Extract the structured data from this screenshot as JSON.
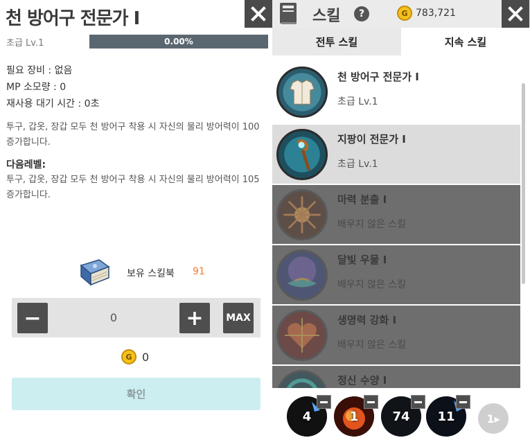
{
  "detail": {
    "title": "천 방어구 전문가 I",
    "level": "초급 Lv.1",
    "progress_text": "0.00%",
    "progress_fraction": 0.0,
    "req_equipment": "필요 장비 : 없음",
    "mp_cost": "MP 소모량 : 0",
    "cooldown": "재사용 대기 시간 : 0초",
    "description": "투구, 갑옷, 장갑 모두 천 방어구 착용 시 자신의 물리 방어력이 100 증가합니다.",
    "next_level_label": "다음레벨:",
    "next_level_description": "투구, 갑옷, 장갑 모두 천 방어구 착용 시 자신의 물리 방어력이 105 증가합니다.",
    "skillbook_label": "보유 스킬북",
    "skillbook_count": "91",
    "stepper": {
      "minus": "−",
      "value": "0",
      "plus": "+",
      "max": "MAX"
    },
    "gold_cost": "0",
    "confirm_label": "확인",
    "close_icon": "close-icon"
  },
  "panel": {
    "title": "스킬",
    "help": "?",
    "gold_symbol": "G",
    "gold_amount": "783,721",
    "tabs": [
      {
        "label": "전투 스킬",
        "active": false
      },
      {
        "label": "지속 스킬",
        "active": true
      }
    ],
    "skills": [
      {
        "name": "천 방어구 전문가 I",
        "status": "초급 Lv.1",
        "state": "learned",
        "icon": "cloth-armor-icon"
      },
      {
        "name": "지팡이 전문가 I",
        "status": "초급 Lv.1",
        "state": "selected",
        "icon": "staff-icon"
      },
      {
        "name": "마력 분출 I",
        "status": "배우지 않은 스킬",
        "state": "locked",
        "icon": "mana-burst-icon"
      },
      {
        "name": "달빛 우물 I",
        "status": "배우지 않은 스킬",
        "state": "locked",
        "icon": "moonlight-well-icon"
      },
      {
        "name": "생명력 강화 I",
        "status": "배우지 않은 스킬",
        "state": "locked",
        "icon": "vitality-icon"
      },
      {
        "name": "정신 수양 I",
        "status": "",
        "state": "locked",
        "icon": "meditation-icon"
      }
    ],
    "quickbar": [
      {
        "label": "4",
        "icon": "ice-skill-icon"
      },
      {
        "label": "1",
        "icon": "fire-skill-icon"
      },
      {
        "label": "74",
        "icon": "blue-skill-icon"
      },
      {
        "label": "11",
        "icon": "lightning-skill-icon"
      }
    ],
    "next_page": "1▸"
  },
  "colors": {
    "accent_orange": "#f07b2c",
    "confirm_bg": "#cdeef1",
    "locked_row": "#6e6e6e",
    "selected_row": "#dcdcdc"
  }
}
